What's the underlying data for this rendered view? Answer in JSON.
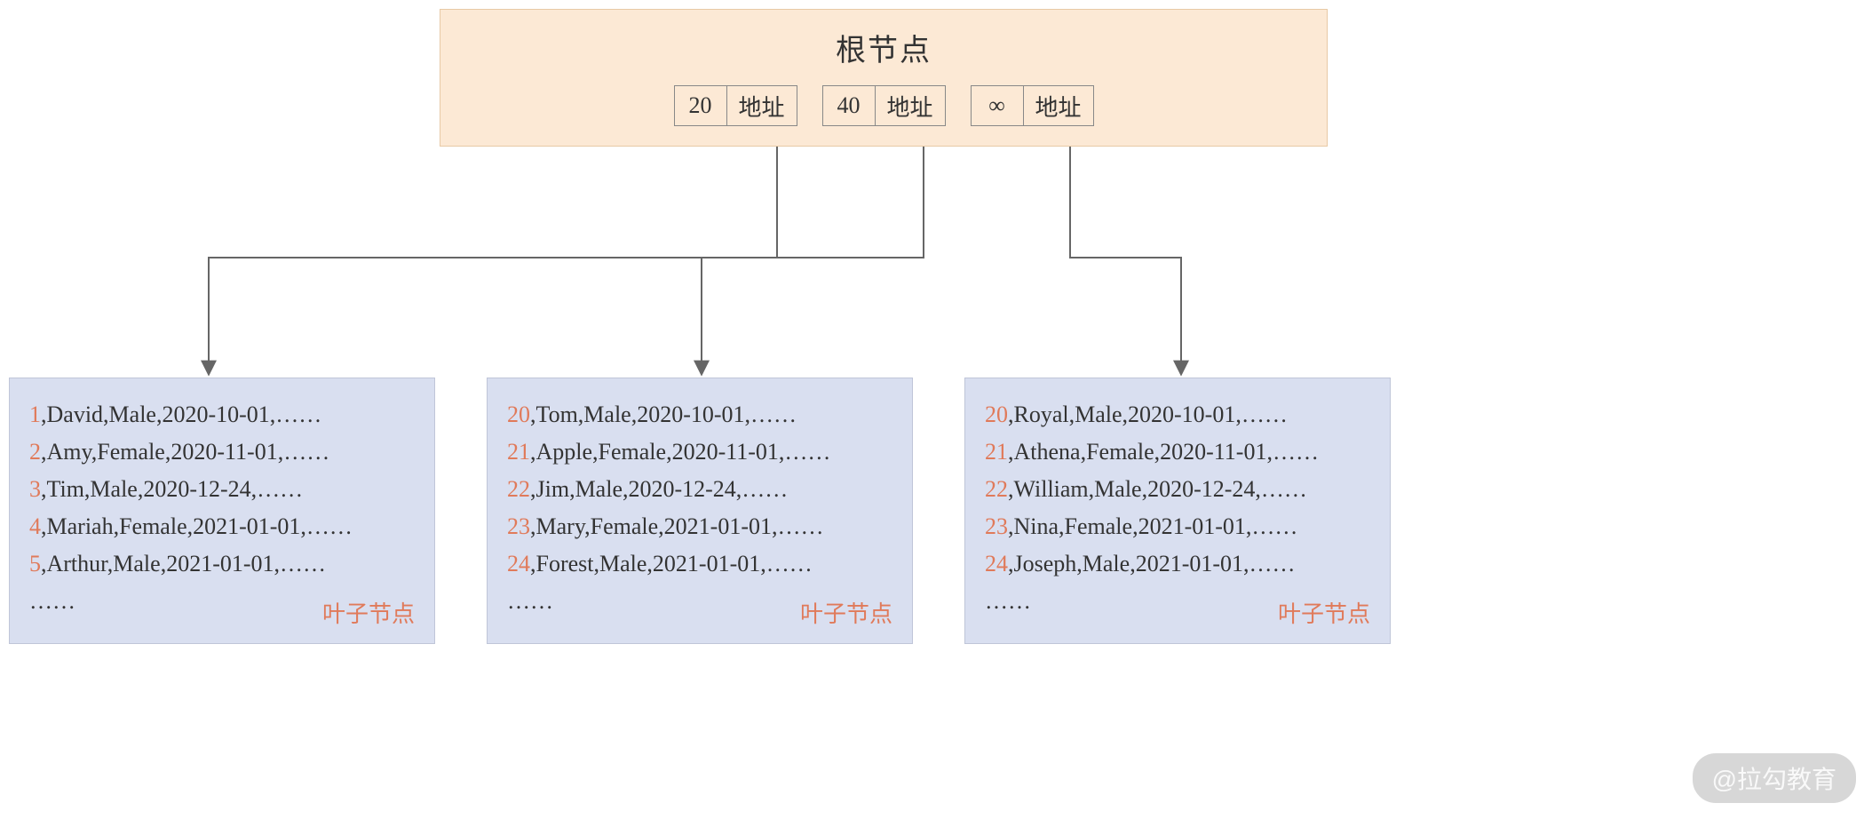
{
  "root": {
    "title": "根节点",
    "addr_label": "地址",
    "entries": [
      {
        "key": "20"
      },
      {
        "key": "40"
      },
      {
        "key": "∞"
      }
    ]
  },
  "leaf_label": "叶子节点",
  "ellipsis": "……",
  "leaves": [
    {
      "rows": [
        {
          "idx": "1",
          "text": ",David,Male,2020-10-01,……"
        },
        {
          "idx": "2",
          "text": ",Amy,Female,2020-11-01,……"
        },
        {
          "idx": "3",
          "text": ",Tim,Male,2020-12-24,……"
        },
        {
          "idx": "4",
          "text": ",Mariah,Female,2021-01-01,……"
        },
        {
          "idx": "5",
          "text": ",Arthur,Male,2021-01-01,……"
        }
      ]
    },
    {
      "rows": [
        {
          "idx": "20",
          "text": ",Tom,Male,2020-10-01,……"
        },
        {
          "idx": "21",
          "text": ",Apple,Female,2020-11-01,……"
        },
        {
          "idx": "22",
          "text": ",Jim,Male,2020-12-24,……"
        },
        {
          "idx": "23",
          "text": ",Mary,Female,2021-01-01,……"
        },
        {
          "idx": "24",
          "text": ",Forest,Male,2021-01-01,……"
        }
      ]
    },
    {
      "rows": [
        {
          "idx": "20",
          "text": ",Royal,Male,2020-10-01,……"
        },
        {
          "idx": "21",
          "text": ",Athena,Female,2020-11-01,……"
        },
        {
          "idx": "22",
          "text": ",William,Male,2020-12-24,……"
        },
        {
          "idx": "23",
          "text": ",Nina,Female,2021-01-01,……"
        },
        {
          "idx": "24",
          "text": ",Joseph,Male,2021-01-01,……"
        }
      ]
    }
  ],
  "watermark": "@拉勾教育"
}
